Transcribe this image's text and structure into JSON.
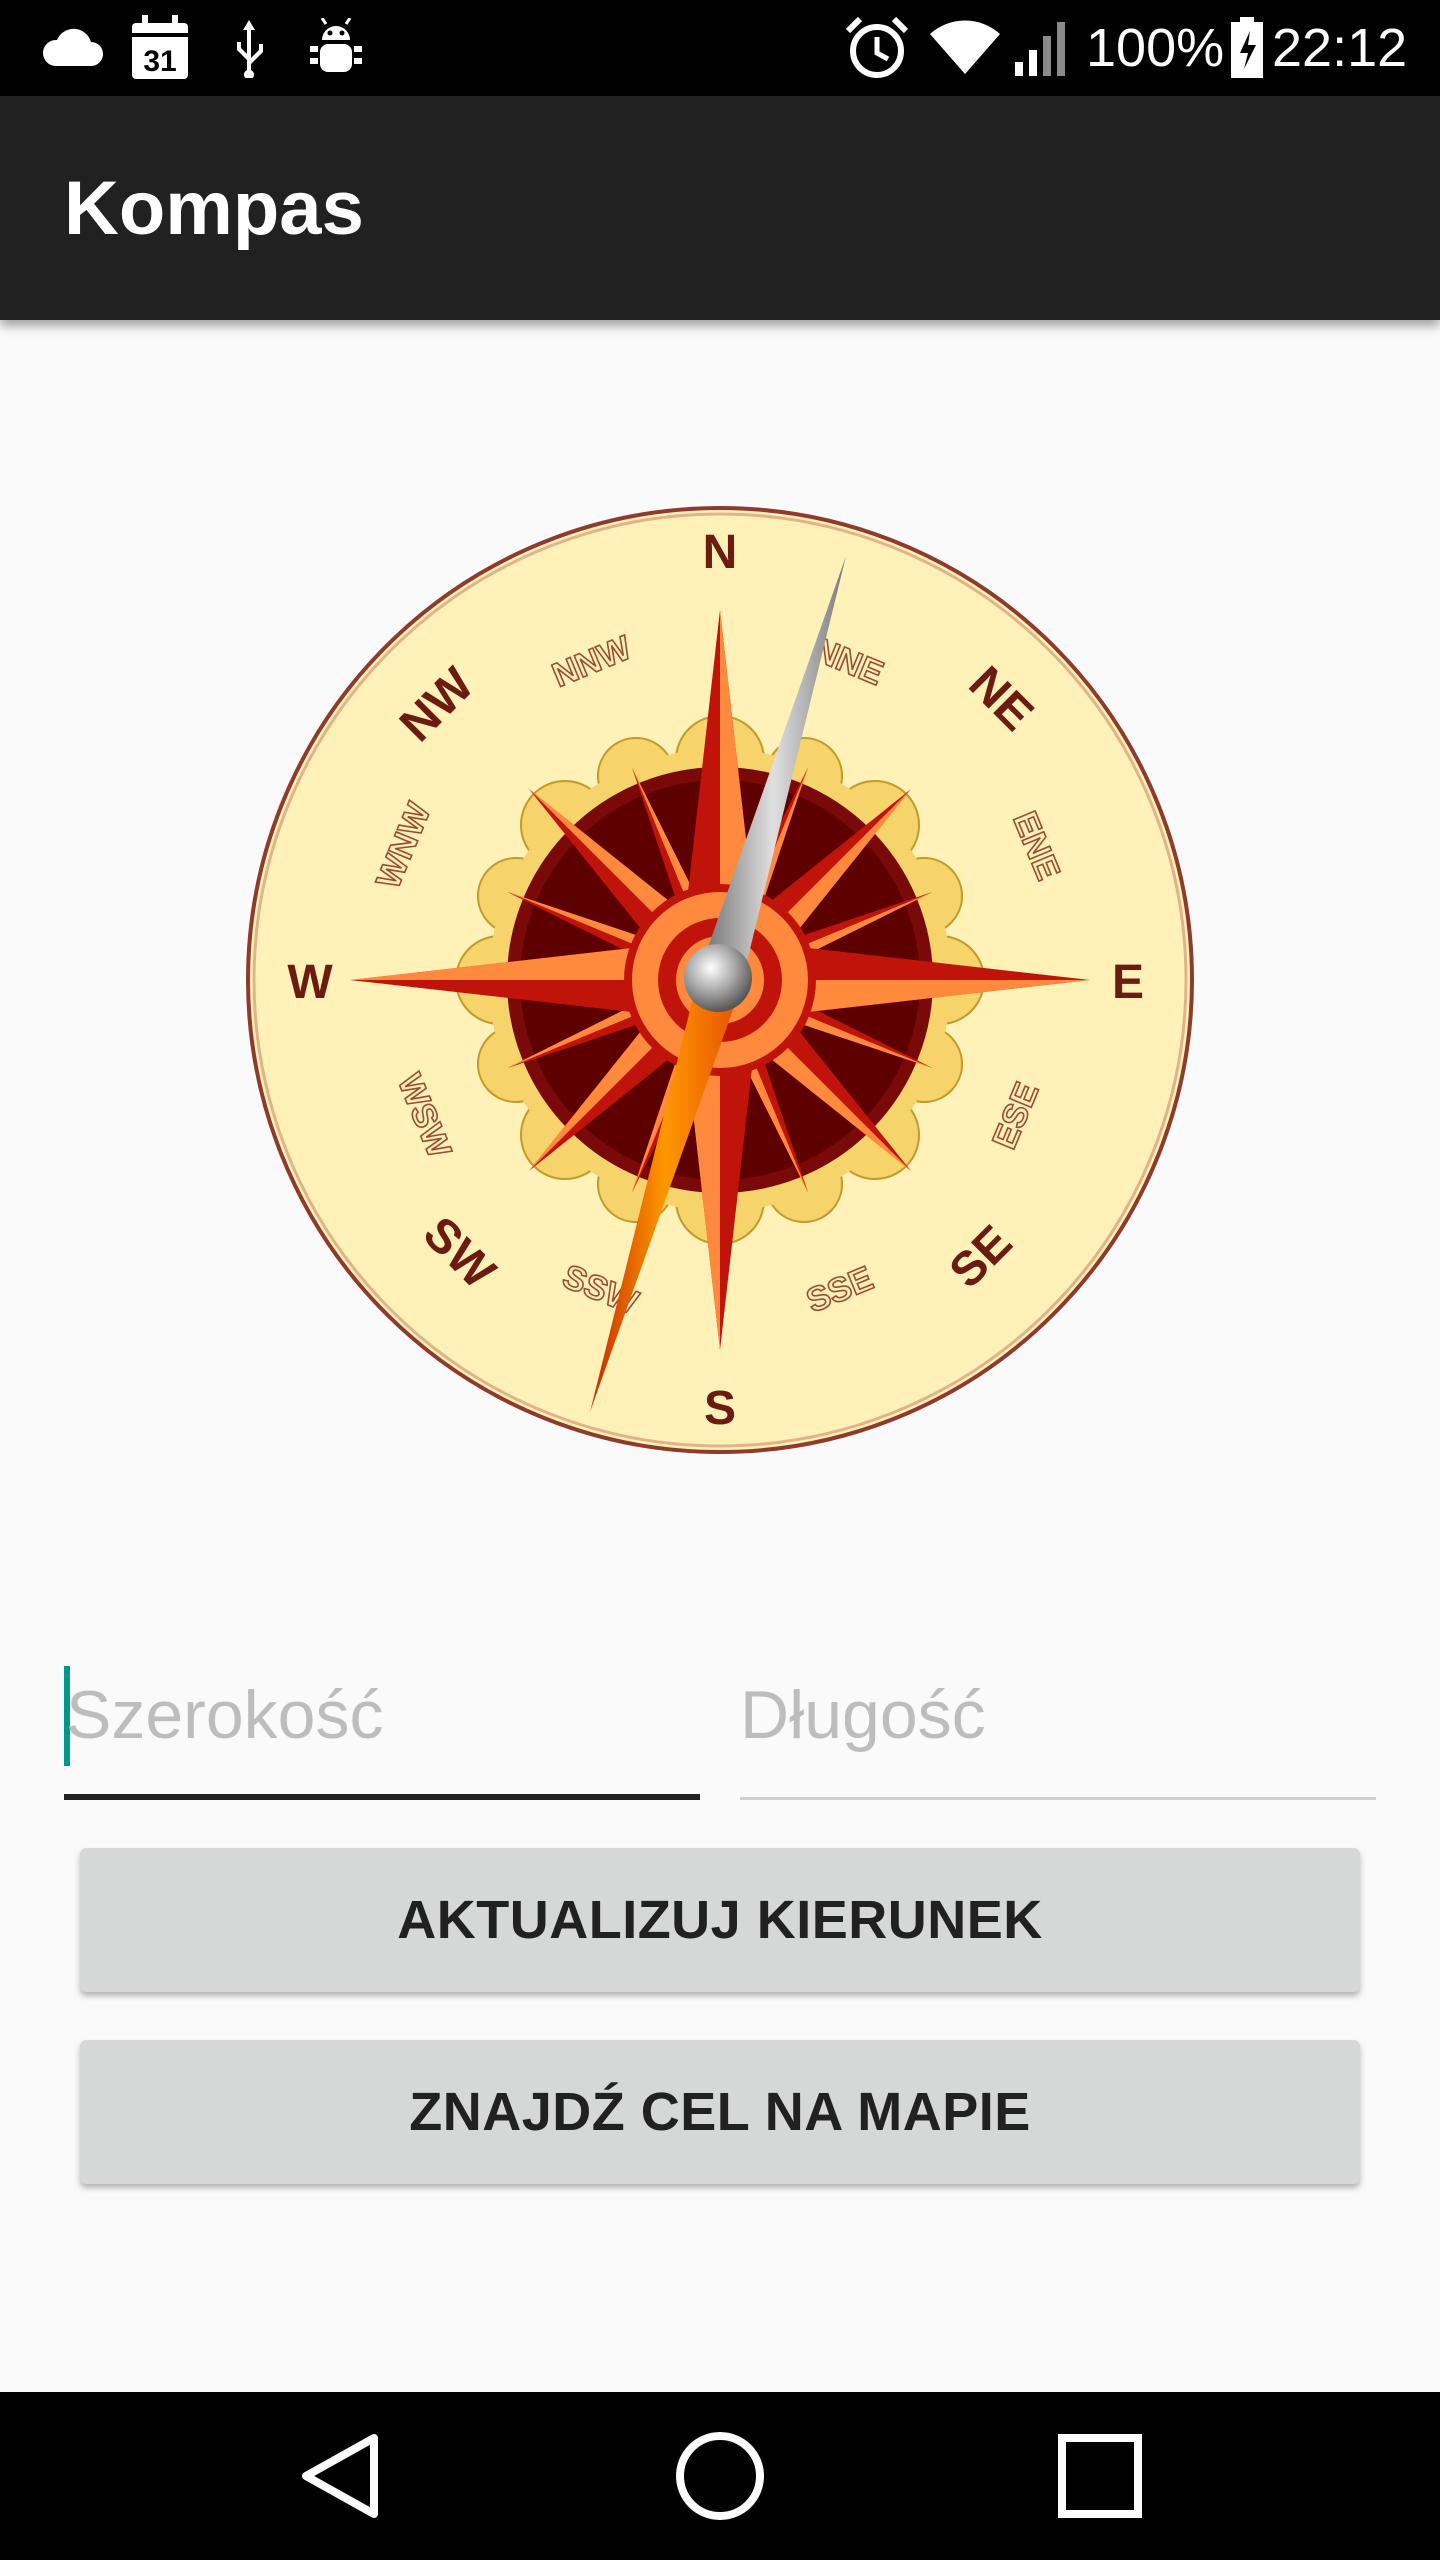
{
  "status_bar": {
    "battery": "100%",
    "time": "22:12",
    "calendar_day": "31",
    "icons": [
      "cloud-icon",
      "calendar-icon",
      "usb-icon",
      "android-debug-icon",
      "alarm-icon",
      "wifi-icon",
      "signal-icon",
      "battery-charging-icon"
    ]
  },
  "app_bar": {
    "title": "Kompas"
  },
  "compass": {
    "labels": {
      "N": "N",
      "S": "S",
      "E": "E",
      "W": "W",
      "NE": "NE",
      "NW": "NW",
      "SE": "SE",
      "SW": "SW",
      "NNW": "NNW",
      "NNE": "NNE",
      "ENE": "ENE",
      "ESE": "ESE",
      "SSE": "SSE",
      "SSW": "SSW",
      "WSW": "WSW",
      "WNW": "WNW"
    },
    "colors": {
      "face": "#fff1b8",
      "rim": "#8e3b2c",
      "star_red": "#c0140a",
      "star_orange": "#ff8a3d",
      "needle_gray": "#9e9e9e",
      "needle_orange": "#ff8c00"
    }
  },
  "form": {
    "latitude_placeholder": "Szerokość",
    "longitude_placeholder": "Długość",
    "accent": "#009688"
  },
  "buttons": {
    "update_label": "AKTUALIZUJ KIERUNEK",
    "map_label": "ZNAJDŹ CEL NA MAPIE"
  },
  "nav_bar": {
    "icons": [
      "back-icon",
      "home-icon",
      "recents-icon"
    ]
  }
}
